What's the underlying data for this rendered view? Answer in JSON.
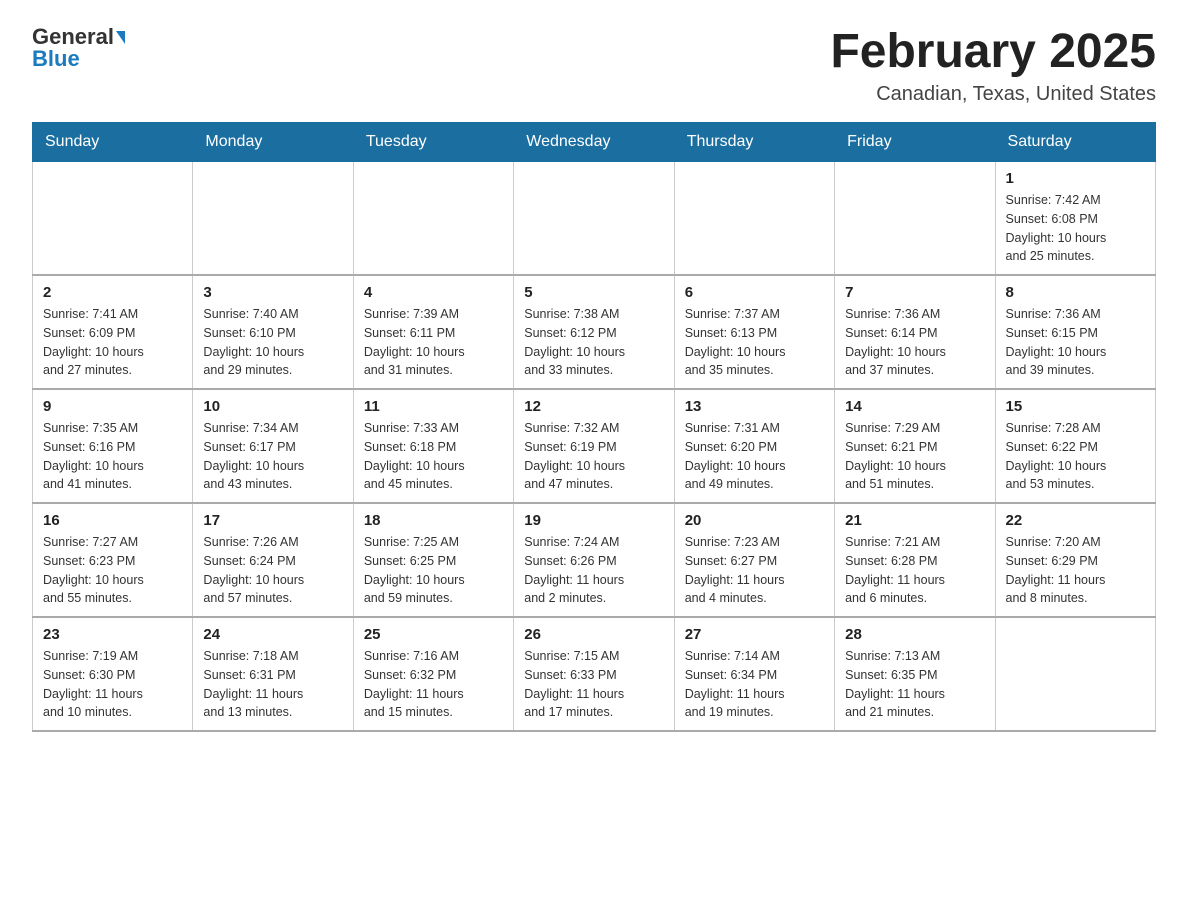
{
  "logo": {
    "general": "General",
    "blue": "Blue"
  },
  "title": "February 2025",
  "subtitle": "Canadian, Texas, United States",
  "days_of_week": [
    "Sunday",
    "Monday",
    "Tuesday",
    "Wednesday",
    "Thursday",
    "Friday",
    "Saturday"
  ],
  "weeks": [
    [
      {
        "day": "",
        "info": ""
      },
      {
        "day": "",
        "info": ""
      },
      {
        "day": "",
        "info": ""
      },
      {
        "day": "",
        "info": ""
      },
      {
        "day": "",
        "info": ""
      },
      {
        "day": "",
        "info": ""
      },
      {
        "day": "1",
        "info": "Sunrise: 7:42 AM\nSunset: 6:08 PM\nDaylight: 10 hours\nand 25 minutes."
      }
    ],
    [
      {
        "day": "2",
        "info": "Sunrise: 7:41 AM\nSunset: 6:09 PM\nDaylight: 10 hours\nand 27 minutes."
      },
      {
        "day": "3",
        "info": "Sunrise: 7:40 AM\nSunset: 6:10 PM\nDaylight: 10 hours\nand 29 minutes."
      },
      {
        "day": "4",
        "info": "Sunrise: 7:39 AM\nSunset: 6:11 PM\nDaylight: 10 hours\nand 31 minutes."
      },
      {
        "day": "5",
        "info": "Sunrise: 7:38 AM\nSunset: 6:12 PM\nDaylight: 10 hours\nand 33 minutes."
      },
      {
        "day": "6",
        "info": "Sunrise: 7:37 AM\nSunset: 6:13 PM\nDaylight: 10 hours\nand 35 minutes."
      },
      {
        "day": "7",
        "info": "Sunrise: 7:36 AM\nSunset: 6:14 PM\nDaylight: 10 hours\nand 37 minutes."
      },
      {
        "day": "8",
        "info": "Sunrise: 7:36 AM\nSunset: 6:15 PM\nDaylight: 10 hours\nand 39 minutes."
      }
    ],
    [
      {
        "day": "9",
        "info": "Sunrise: 7:35 AM\nSunset: 6:16 PM\nDaylight: 10 hours\nand 41 minutes."
      },
      {
        "day": "10",
        "info": "Sunrise: 7:34 AM\nSunset: 6:17 PM\nDaylight: 10 hours\nand 43 minutes."
      },
      {
        "day": "11",
        "info": "Sunrise: 7:33 AM\nSunset: 6:18 PM\nDaylight: 10 hours\nand 45 minutes."
      },
      {
        "day": "12",
        "info": "Sunrise: 7:32 AM\nSunset: 6:19 PM\nDaylight: 10 hours\nand 47 minutes."
      },
      {
        "day": "13",
        "info": "Sunrise: 7:31 AM\nSunset: 6:20 PM\nDaylight: 10 hours\nand 49 minutes."
      },
      {
        "day": "14",
        "info": "Sunrise: 7:29 AM\nSunset: 6:21 PM\nDaylight: 10 hours\nand 51 minutes."
      },
      {
        "day": "15",
        "info": "Sunrise: 7:28 AM\nSunset: 6:22 PM\nDaylight: 10 hours\nand 53 minutes."
      }
    ],
    [
      {
        "day": "16",
        "info": "Sunrise: 7:27 AM\nSunset: 6:23 PM\nDaylight: 10 hours\nand 55 minutes."
      },
      {
        "day": "17",
        "info": "Sunrise: 7:26 AM\nSunset: 6:24 PM\nDaylight: 10 hours\nand 57 minutes."
      },
      {
        "day": "18",
        "info": "Sunrise: 7:25 AM\nSunset: 6:25 PM\nDaylight: 10 hours\nand 59 minutes."
      },
      {
        "day": "19",
        "info": "Sunrise: 7:24 AM\nSunset: 6:26 PM\nDaylight: 11 hours\nand 2 minutes."
      },
      {
        "day": "20",
        "info": "Sunrise: 7:23 AM\nSunset: 6:27 PM\nDaylight: 11 hours\nand 4 minutes."
      },
      {
        "day": "21",
        "info": "Sunrise: 7:21 AM\nSunset: 6:28 PM\nDaylight: 11 hours\nand 6 minutes."
      },
      {
        "day": "22",
        "info": "Sunrise: 7:20 AM\nSunset: 6:29 PM\nDaylight: 11 hours\nand 8 minutes."
      }
    ],
    [
      {
        "day": "23",
        "info": "Sunrise: 7:19 AM\nSunset: 6:30 PM\nDaylight: 11 hours\nand 10 minutes."
      },
      {
        "day": "24",
        "info": "Sunrise: 7:18 AM\nSunset: 6:31 PM\nDaylight: 11 hours\nand 13 minutes."
      },
      {
        "day": "25",
        "info": "Sunrise: 7:16 AM\nSunset: 6:32 PM\nDaylight: 11 hours\nand 15 minutes."
      },
      {
        "day": "26",
        "info": "Sunrise: 7:15 AM\nSunset: 6:33 PM\nDaylight: 11 hours\nand 17 minutes."
      },
      {
        "day": "27",
        "info": "Sunrise: 7:14 AM\nSunset: 6:34 PM\nDaylight: 11 hours\nand 19 minutes."
      },
      {
        "day": "28",
        "info": "Sunrise: 7:13 AM\nSunset: 6:35 PM\nDaylight: 11 hours\nand 21 minutes."
      },
      {
        "day": "",
        "info": ""
      }
    ]
  ]
}
